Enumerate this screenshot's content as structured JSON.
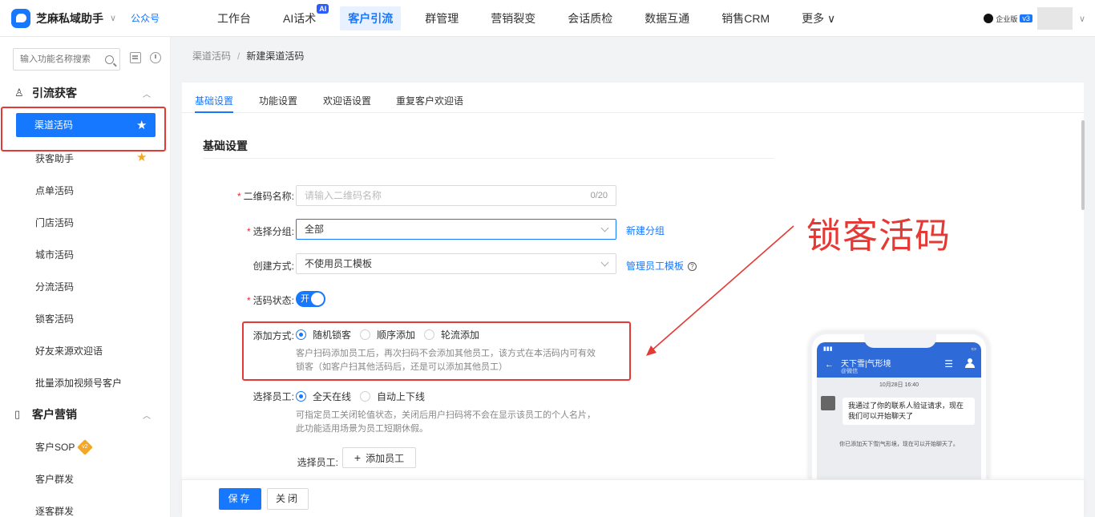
{
  "app": {
    "name": "芝麻私域助手",
    "gzh": "公众号",
    "nav": [
      {
        "label": "工作台"
      },
      {
        "label": "AI话术",
        "badge": "AI"
      },
      {
        "label": "客户引流",
        "active": true
      },
      {
        "label": "群管理"
      },
      {
        "label": "营销裂变"
      },
      {
        "label": "会话质检"
      },
      {
        "label": "数据互通"
      },
      {
        "label": "销售CRM"
      },
      {
        "label": "更多 ∨"
      }
    ],
    "edition": "企业版",
    "edition_version": "v3"
  },
  "sidebar": {
    "search_placeholder": "输入功能名称搜索",
    "group1": {
      "label": "引流获客"
    },
    "items1": [
      {
        "label": "渠道活码",
        "active": true
      },
      {
        "label": "获客助手"
      },
      {
        "label": "点单活码"
      },
      {
        "label": "门店活码"
      },
      {
        "label": "城市活码"
      },
      {
        "label": "分流活码"
      },
      {
        "label": "锁客活码"
      },
      {
        "label": "好友来源欢迎语"
      },
      {
        "label": "批量添加视频号客户"
      }
    ],
    "group2": {
      "label": "客户营销"
    },
    "items2": [
      {
        "label": "客户SOP",
        "badge": "v2"
      },
      {
        "label": "客户群发"
      },
      {
        "label": "逐客群发"
      }
    ]
  },
  "breadcrumb": {
    "parent": "渠道活码",
    "current": "新建渠道活码"
  },
  "tabs": [
    "基础设置",
    "功能设置",
    "欢迎语设置",
    "重复客户欢迎语"
  ],
  "form": {
    "section_title": "基础设置",
    "qrname_label": "二维码名称:",
    "qrname_placeholder": "请输入二维码名称",
    "qrname_count": "0/20",
    "group_label": "选择分组:",
    "group_value": "全部",
    "new_group_link": "新建分组",
    "create_label": "创建方式:",
    "create_value": "不使用员工模板",
    "manage_template_link": "管理员工模板",
    "status_label": "活码状态:",
    "status_toggle": "开",
    "add_mode_label": "添加方式:",
    "add_modes": [
      "随机锁客",
      "顺序添加",
      "轮流添加"
    ],
    "add_mode_hint_1": "客户扫码添加员工后，再次扫码不会添加其他员工，该方式在本活码内可有效",
    "add_mode_hint_2": "锁客（如客户扫其他活码后，还是可以添加其他员工）",
    "staff_label": "选择员工:",
    "staff_modes": [
      "全天在线",
      "自动上下线"
    ],
    "staff_hint_1": "可指定员工关闭轮值状态，关闭后用户扫码将不会在显示该员工的个人名片，",
    "staff_hint_2": "此功能适用场景为员工短期休假。",
    "staff_select_label": "选择员工:",
    "add_staff_button": "添加员工"
  },
  "callout": "锁客活码",
  "phone": {
    "title": "天下雪|气形境",
    "subtitle": "@微信",
    "time": "10月28日 16:40",
    "message": "我通过了你的联系人验证请求，现在我们可以开始聊天了",
    "system": "你已添加天下雪|气形境，现在可以开始聊天了。"
  },
  "footer": {
    "save": "保存",
    "close": "关闭"
  },
  "colors": {
    "primary": "#1677ff",
    "annotation": "#e53935"
  }
}
